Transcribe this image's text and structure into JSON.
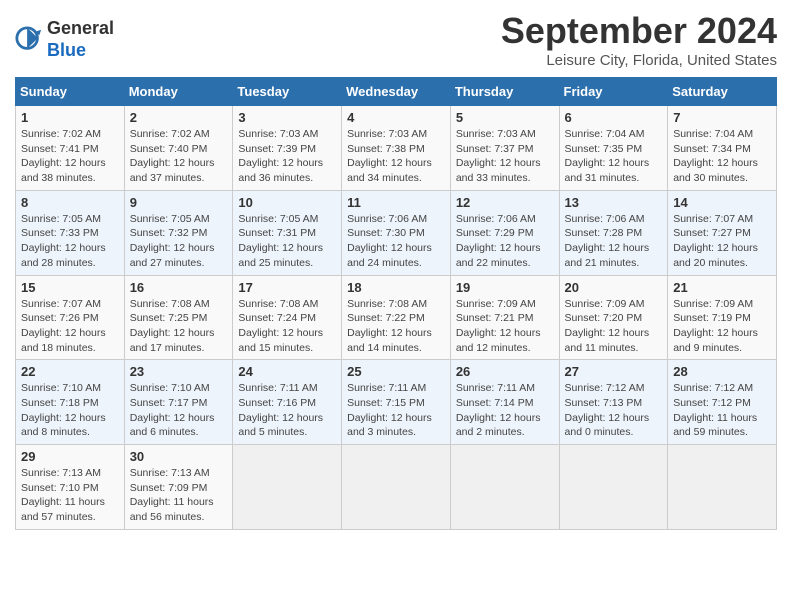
{
  "header": {
    "logo_general": "General",
    "logo_blue": "Blue",
    "month_title": "September 2024",
    "location": "Leisure City, Florida, United States"
  },
  "days_of_week": [
    "Sunday",
    "Monday",
    "Tuesday",
    "Wednesday",
    "Thursday",
    "Friday",
    "Saturday"
  ],
  "weeks": [
    [
      {
        "day": "1",
        "info": "Sunrise: 7:02 AM\nSunset: 7:41 PM\nDaylight: 12 hours\nand 38 minutes."
      },
      {
        "day": "2",
        "info": "Sunrise: 7:02 AM\nSunset: 7:40 PM\nDaylight: 12 hours\nand 37 minutes."
      },
      {
        "day": "3",
        "info": "Sunrise: 7:03 AM\nSunset: 7:39 PM\nDaylight: 12 hours\nand 36 minutes."
      },
      {
        "day": "4",
        "info": "Sunrise: 7:03 AM\nSunset: 7:38 PM\nDaylight: 12 hours\nand 34 minutes."
      },
      {
        "day": "5",
        "info": "Sunrise: 7:03 AM\nSunset: 7:37 PM\nDaylight: 12 hours\nand 33 minutes."
      },
      {
        "day": "6",
        "info": "Sunrise: 7:04 AM\nSunset: 7:35 PM\nDaylight: 12 hours\nand 31 minutes."
      },
      {
        "day": "7",
        "info": "Sunrise: 7:04 AM\nSunset: 7:34 PM\nDaylight: 12 hours\nand 30 minutes."
      }
    ],
    [
      {
        "day": "8",
        "info": "Sunrise: 7:05 AM\nSunset: 7:33 PM\nDaylight: 12 hours\nand 28 minutes."
      },
      {
        "day": "9",
        "info": "Sunrise: 7:05 AM\nSunset: 7:32 PM\nDaylight: 12 hours\nand 27 minutes."
      },
      {
        "day": "10",
        "info": "Sunrise: 7:05 AM\nSunset: 7:31 PM\nDaylight: 12 hours\nand 25 minutes."
      },
      {
        "day": "11",
        "info": "Sunrise: 7:06 AM\nSunset: 7:30 PM\nDaylight: 12 hours\nand 24 minutes."
      },
      {
        "day": "12",
        "info": "Sunrise: 7:06 AM\nSunset: 7:29 PM\nDaylight: 12 hours\nand 22 minutes."
      },
      {
        "day": "13",
        "info": "Sunrise: 7:06 AM\nSunset: 7:28 PM\nDaylight: 12 hours\nand 21 minutes."
      },
      {
        "day": "14",
        "info": "Sunrise: 7:07 AM\nSunset: 7:27 PM\nDaylight: 12 hours\nand 20 minutes."
      }
    ],
    [
      {
        "day": "15",
        "info": "Sunrise: 7:07 AM\nSunset: 7:26 PM\nDaylight: 12 hours\nand 18 minutes."
      },
      {
        "day": "16",
        "info": "Sunrise: 7:08 AM\nSunset: 7:25 PM\nDaylight: 12 hours\nand 17 minutes."
      },
      {
        "day": "17",
        "info": "Sunrise: 7:08 AM\nSunset: 7:24 PM\nDaylight: 12 hours\nand 15 minutes."
      },
      {
        "day": "18",
        "info": "Sunrise: 7:08 AM\nSunset: 7:22 PM\nDaylight: 12 hours\nand 14 minutes."
      },
      {
        "day": "19",
        "info": "Sunrise: 7:09 AM\nSunset: 7:21 PM\nDaylight: 12 hours\nand 12 minutes."
      },
      {
        "day": "20",
        "info": "Sunrise: 7:09 AM\nSunset: 7:20 PM\nDaylight: 12 hours\nand 11 minutes."
      },
      {
        "day": "21",
        "info": "Sunrise: 7:09 AM\nSunset: 7:19 PM\nDaylight: 12 hours\nand 9 minutes."
      }
    ],
    [
      {
        "day": "22",
        "info": "Sunrise: 7:10 AM\nSunset: 7:18 PM\nDaylight: 12 hours\nand 8 minutes."
      },
      {
        "day": "23",
        "info": "Sunrise: 7:10 AM\nSunset: 7:17 PM\nDaylight: 12 hours\nand 6 minutes."
      },
      {
        "day": "24",
        "info": "Sunrise: 7:11 AM\nSunset: 7:16 PM\nDaylight: 12 hours\nand 5 minutes."
      },
      {
        "day": "25",
        "info": "Sunrise: 7:11 AM\nSunset: 7:15 PM\nDaylight: 12 hours\nand 3 minutes."
      },
      {
        "day": "26",
        "info": "Sunrise: 7:11 AM\nSunset: 7:14 PM\nDaylight: 12 hours\nand 2 minutes."
      },
      {
        "day": "27",
        "info": "Sunrise: 7:12 AM\nSunset: 7:13 PM\nDaylight: 12 hours\nand 0 minutes."
      },
      {
        "day": "28",
        "info": "Sunrise: 7:12 AM\nSunset: 7:12 PM\nDaylight: 11 hours\nand 59 minutes."
      }
    ],
    [
      {
        "day": "29",
        "info": "Sunrise: 7:13 AM\nSunset: 7:10 PM\nDaylight: 11 hours\nand 57 minutes."
      },
      {
        "day": "30",
        "info": "Sunrise: 7:13 AM\nSunset: 7:09 PM\nDaylight: 11 hours\nand 56 minutes."
      },
      {
        "day": "",
        "info": ""
      },
      {
        "day": "",
        "info": ""
      },
      {
        "day": "",
        "info": ""
      },
      {
        "day": "",
        "info": ""
      },
      {
        "day": "",
        "info": ""
      }
    ]
  ]
}
